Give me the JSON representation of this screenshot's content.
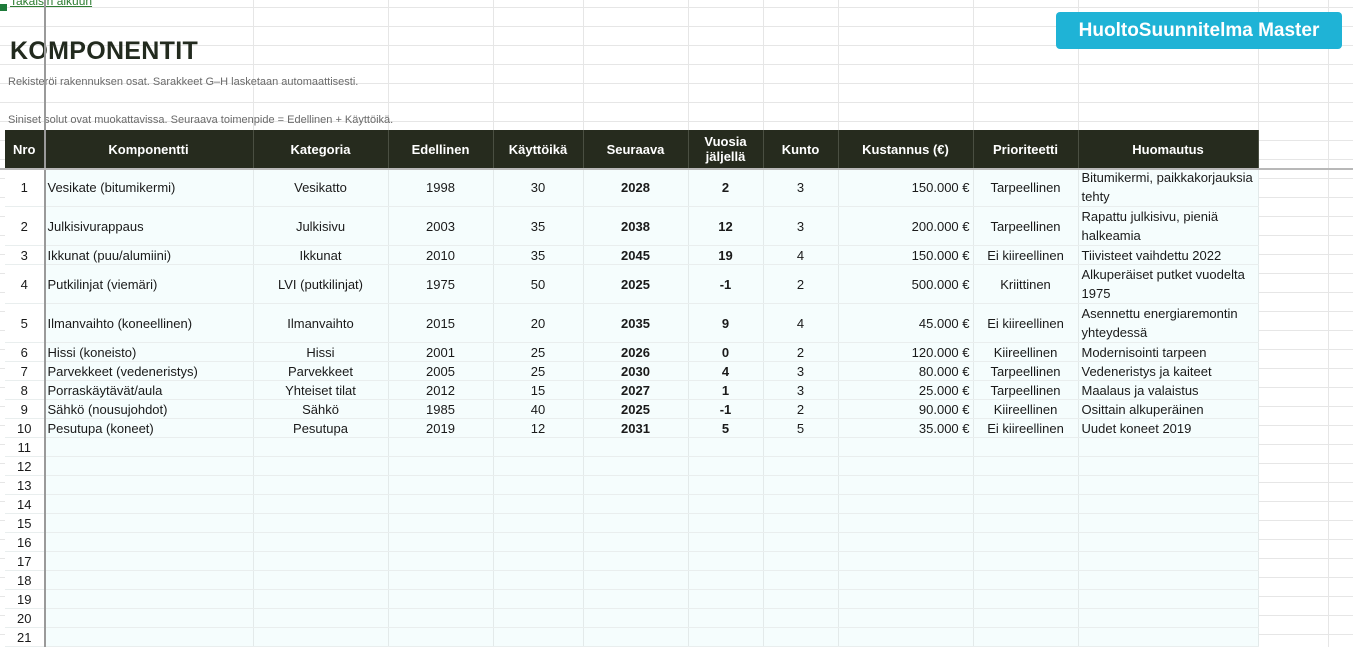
{
  "nav": {
    "back_label": "Takaisin alkuun"
  },
  "brand": {
    "label": "HuoltoSuunnitelma Master",
    "color": "#1fb3d6"
  },
  "page": {
    "title": "KOMPONENTIT",
    "subtitle1": "Rekisteröi rakennuksen osat. Sarakkeet G–H lasketaan automaattisesti.",
    "subtitle2": "Siniset solut ovat muokattavissa. Seuraava toimenpide = Edellinen + Käyttöikä."
  },
  "table": {
    "header_color": "#262b1e",
    "headers": {
      "nro": "Nro",
      "komponentti": "Komponentti",
      "kategoria": "Kategoria",
      "edellinen": "Edellinen",
      "kayttoika": "Käyttöikä",
      "seuraava": "Seuraava",
      "vuosia_1": "Vuosia",
      "vuosia_2": "jäljellä",
      "kunto": "Kunto",
      "kustannus": "Kustannus (€)",
      "prioriteetti": "Prioriteetti",
      "huomautus": "Huomautus"
    },
    "rows": [
      {
        "nro": "1",
        "komponentti": "Vesikate (bitumikermi)",
        "kategoria": "Vesikatto",
        "edellinen": "1998",
        "kayttoika": "30",
        "seuraava": "2028",
        "vuosia": "2",
        "kunto": "3",
        "kustannus": "150.000 €",
        "prioriteetti": "Tarpeellinen",
        "huomautus": "Bitumikermi, paikkakorjauksia tehty"
      },
      {
        "nro": "2",
        "komponentti": "Julkisivurappaus",
        "kategoria": "Julkisivu",
        "edellinen": "2003",
        "kayttoika": "35",
        "seuraava": "2038",
        "vuosia": "12",
        "kunto": "3",
        "kustannus": "200.000 €",
        "prioriteetti": "Tarpeellinen",
        "huomautus": "Rapattu julkisivu, pieniä halkeamia"
      },
      {
        "nro": "3",
        "komponentti": "Ikkunat (puu/alumiini)",
        "kategoria": "Ikkunat",
        "edellinen": "2010",
        "kayttoika": "35",
        "seuraava": "2045",
        "vuosia": "19",
        "kunto": "4",
        "kustannus": "150.000 €",
        "prioriteetti": "Ei kiireellinen",
        "huomautus": "Tiivisteet vaihdettu 2022"
      },
      {
        "nro": "4",
        "komponentti": "Putkilinjat (viemäri)",
        "kategoria": "LVI (putkilinjat)",
        "edellinen": "1975",
        "kayttoika": "50",
        "seuraava": "2025",
        "vuosia": "-1",
        "kunto": "2",
        "kustannus": "500.000 €",
        "prioriteetti": "Kriittinen",
        "huomautus": "Alkuperäiset putket vuodelta 1975"
      },
      {
        "nro": "5",
        "komponentti": "Ilmanvaihto (koneellinen)",
        "kategoria": "Ilmanvaihto",
        "edellinen": "2015",
        "kayttoika": "20",
        "seuraava": "2035",
        "vuosia": "9",
        "kunto": "4",
        "kustannus": "45.000 €",
        "prioriteetti": "Ei kiireellinen",
        "huomautus": "Asennettu energiaremontin yhteydessä"
      },
      {
        "nro": "6",
        "komponentti": "Hissi (koneisto)",
        "kategoria": "Hissi",
        "edellinen": "2001",
        "kayttoika": "25",
        "seuraava": "2026",
        "vuosia": "0",
        "kunto": "2",
        "kustannus": "120.000 €",
        "prioriteetti": "Kiireellinen",
        "huomautus": "Modernisointi tarpeen"
      },
      {
        "nro": "7",
        "komponentti": "Parvekkeet (vedeneristys)",
        "kategoria": "Parvekkeet",
        "edellinen": "2005",
        "kayttoika": "25",
        "seuraava": "2030",
        "vuosia": "4",
        "kunto": "3",
        "kustannus": "80.000 €",
        "prioriteetti": "Tarpeellinen",
        "huomautus": "Vedeneristys ja kaiteet"
      },
      {
        "nro": "8",
        "komponentti": "Porraskäytävät/aula",
        "kategoria": "Yhteiset tilat",
        "edellinen": "2012",
        "kayttoika": "15",
        "seuraava": "2027",
        "vuosia": "1",
        "kunto": "3",
        "kustannus": "25.000 €",
        "prioriteetti": "Tarpeellinen",
        "huomautus": "Maalaus ja valaistus"
      },
      {
        "nro": "9",
        "komponentti": "Sähkö (nousujohdot)",
        "kategoria": "Sähkö",
        "edellinen": "1985",
        "kayttoika": "40",
        "seuraava": "2025",
        "vuosia": "-1",
        "kunto": "2",
        "kustannus": "90.000 €",
        "prioriteetti": "Kiireellinen",
        "huomautus": "Osittain alkuperäinen"
      },
      {
        "nro": "10",
        "komponentti": "Pesutupa (koneet)",
        "kategoria": "Pesutupa",
        "edellinen": "2019",
        "kayttoika": "12",
        "seuraava": "2031",
        "vuosia": "5",
        "kunto": "5",
        "kustannus": "35.000 €",
        "prioriteetti": "Ei kiireellinen",
        "huomautus": "Uudet koneet 2019"
      }
    ],
    "empty_rows": [
      "11",
      "12",
      "13",
      "14",
      "15",
      "16",
      "17",
      "18",
      "19",
      "20",
      "21"
    ]
  }
}
